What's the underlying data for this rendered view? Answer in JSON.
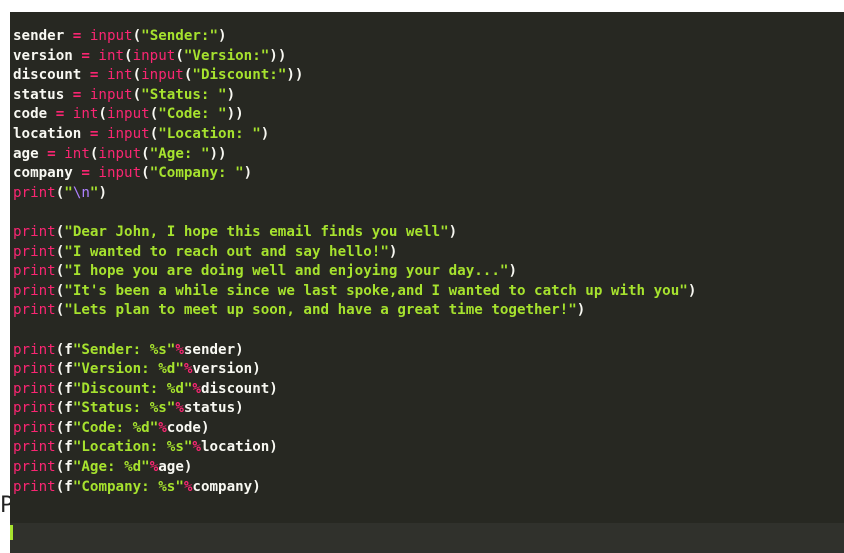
{
  "assignments": [
    {
      "var": "sender",
      "wrap": "",
      "arg": "Sender:"
    },
    {
      "var": "version",
      "wrap": "int",
      "arg": "Version:"
    },
    {
      "var": "discount",
      "wrap": "int",
      "arg": "Discount:"
    },
    {
      "var": "status",
      "wrap": "",
      "arg": "Status: "
    },
    {
      "var": "code",
      "wrap": "int",
      "arg": "Code: "
    },
    {
      "var": "location",
      "wrap": "",
      "arg": "Location: "
    },
    {
      "var": "age",
      "wrap": "int",
      "arg": "Age: "
    },
    {
      "var": "company",
      "wrap": "",
      "arg": "Company: "
    }
  ],
  "keywords": {
    "input": "input",
    "int": "int",
    "print": "print",
    "assign": " = "
  },
  "newline_print": {
    "escape": "\\n"
  },
  "messages": [
    "Dear John, I hope this email finds you well",
    "I wanted to reach out and say hello!",
    "I hope you are doing well and enjoying your day...",
    "It's been a while since we last spoke,and I wanted to catch up with you",
    "Lets plan to meet up soon, and have a great time together!"
  ],
  "formatted": [
    {
      "text": "Sender: %s",
      "var": "sender"
    },
    {
      "text": "Version: %d",
      "var": "version"
    },
    {
      "text": "Discount: %d",
      "var": "discount"
    },
    {
      "text": "Status: %s",
      "var": "status"
    },
    {
      "text": "Code: %d",
      "var": "code"
    },
    {
      "text": "Location: %s",
      "var": "location"
    },
    {
      "text": "Age: %d",
      "var": "age"
    },
    {
      "text": "Company: %s",
      "var": "company"
    }
  ],
  "stray_text": "P",
  "colors": {
    "background": "#272822",
    "keyword": "#f92672",
    "string": "#a6e22e",
    "identifier": "#f8f8f2",
    "escape": "#ae81ff"
  }
}
